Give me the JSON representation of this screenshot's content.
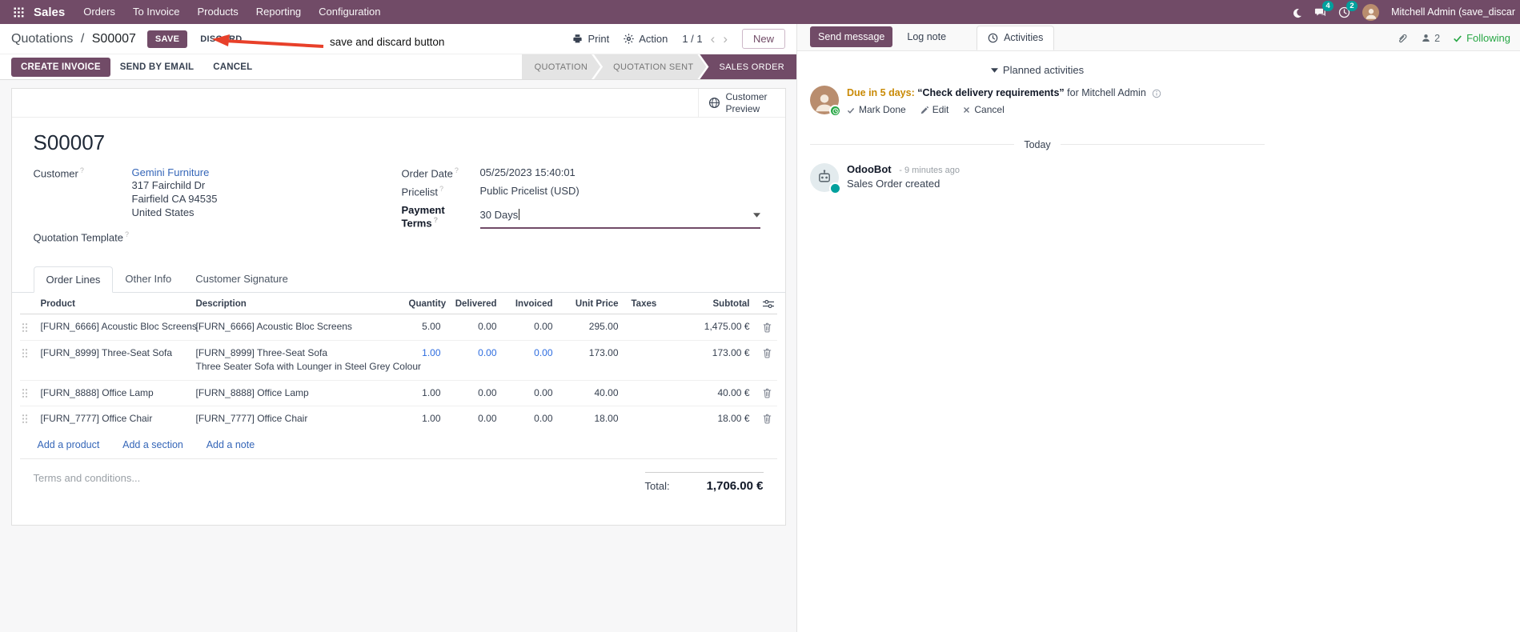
{
  "navbar": {
    "app_name": "Sales",
    "menus": [
      "Orders",
      "To Invoice",
      "Products",
      "Reporting",
      "Configuration"
    ],
    "messages_badge": "4",
    "activities_badge": "2",
    "user_name": "Mitchell Admin (save_discar"
  },
  "control_panel": {
    "breadcrumb_parent": "Quotations",
    "separator": "/",
    "record": "S00007",
    "save": "SAVE",
    "discard": "DISCARD",
    "annotation": "save and discard button",
    "print": "Print",
    "action": "Action",
    "pager": "1 / 1",
    "prev": "‹",
    "next": "›",
    "new": "New"
  },
  "statusbar": {
    "create_invoice": "CREATE INVOICE",
    "send_by_email": "SEND BY EMAIL",
    "cancel": "CANCEL",
    "steps": [
      "QUOTATION",
      "QUOTATION SENT",
      "SALES ORDER"
    ],
    "active_step": "SALES ORDER"
  },
  "sheet": {
    "customer_preview": "Customer Preview",
    "title": "S00007",
    "help": "?",
    "customer_label": "Customer",
    "customer": "Gemini Furniture",
    "address": [
      "317 Fairchild Dr",
      "Fairfield CA 94535",
      "United States"
    ],
    "quotation_template_label": "Quotation Template",
    "order_date_label": "Order Date",
    "order_date": "05/25/2023 15:40:01",
    "pricelist_label": "Pricelist",
    "pricelist": "Public Pricelist (USD)",
    "payment_terms_label": "Payment Terms",
    "payment_terms": "30 Days",
    "tabs": [
      "Order Lines",
      "Other Info",
      "Customer Signature"
    ],
    "columns": [
      "Product",
      "Description",
      "Quantity",
      "Delivered",
      "Invoiced",
      "Unit Price",
      "Taxes",
      "Subtotal"
    ],
    "rows": [
      {
        "product": "[FURN_6666] Acoustic Bloc Screens",
        "desc": "[FURN_6666] Acoustic Bloc Screens",
        "desc2": "",
        "qty": "5.00",
        "delivered": "0.00",
        "invoiced": "0.00",
        "price": "295.00",
        "taxes": "",
        "subtotal": "1,475.00 €"
      },
      {
        "product": "[FURN_8999] Three-Seat Sofa",
        "desc": "[FURN_8999] Three-Seat Sofa",
        "desc2": "Three Seater Sofa with Lounger in Steel Grey Colour",
        "qty": "1.00",
        "delivered": "0.00",
        "invoiced": "0.00",
        "price": "173.00",
        "taxes": "",
        "subtotal": "173.00 €"
      },
      {
        "product": "[FURN_8888] Office Lamp",
        "desc": "[FURN_8888] Office Lamp",
        "desc2": "",
        "qty": "1.00",
        "delivered": "0.00",
        "invoiced": "0.00",
        "price": "40.00",
        "taxes": "",
        "subtotal": "40.00 €"
      },
      {
        "product": "[FURN_7777] Office Chair",
        "desc": "[FURN_7777] Office Chair",
        "desc2": "",
        "qty": "1.00",
        "delivered": "0.00",
        "invoiced": "0.00",
        "price": "18.00",
        "taxes": "",
        "subtotal": "18.00 €"
      }
    ],
    "add_product": "Add a product",
    "add_section": "Add a section",
    "add_note": "Add a note",
    "terms_placeholder": "Terms and conditions...",
    "total_label": "Total:",
    "total": "1,706.00 €"
  },
  "chatter": {
    "send_message": "Send message",
    "log_note": "Log note",
    "activities": "Activities",
    "followers_count": "2",
    "following": "Following",
    "planned_header": "Planned activities",
    "activity_due": "Due in 5 days:",
    "activity_summary": "“Check delivery requirements”",
    "activity_for": "for Mitchell Admin",
    "mark_done": "Mark Done",
    "edit": "Edit",
    "cancel": "Cancel",
    "today": "Today",
    "author": "OdooBot",
    "time": "- 9 minutes ago",
    "message": "Sales Order created"
  },
  "icons": {
    "apps-menu-icon": "3x3 grid",
    "dark-mode-icon": "moon",
    "messages-icon": "speech bubble",
    "activity-clock-icon": "clock",
    "print-icon": "printer",
    "action-icon": "gear",
    "customer-preview-icon": "globe",
    "columns-settings-icon": "sliders",
    "drag-handle-icon": "dots",
    "delete-icon": "trash",
    "attachment-icon": "paperclip",
    "followers-icon": "person",
    "following-icon": "check"
  },
  "colors": {
    "primary": "#714B67",
    "link": "#3566b8",
    "modified_value": "#2d6cdf",
    "systray_badge": "#00A09D",
    "due_amber": "#c98a06",
    "annotation_red": "#e8402a",
    "following_green": "#28a745"
  }
}
